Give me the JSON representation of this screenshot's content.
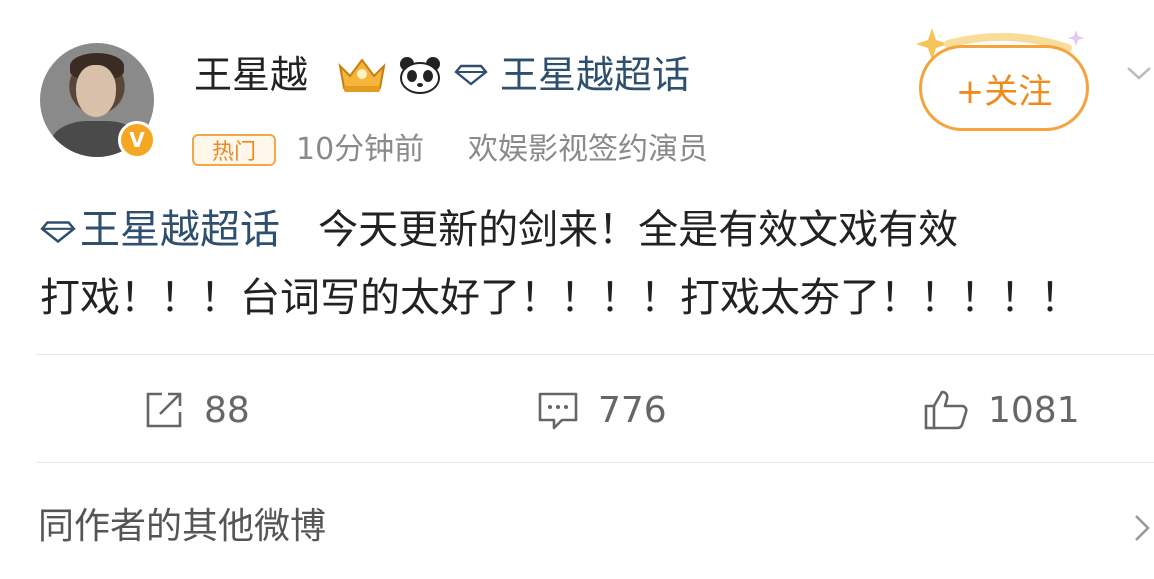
{
  "author": {
    "name": "王星越",
    "verified_mark": "V"
  },
  "header_topic": {
    "label": "王星越超话",
    "icon": "diamond-icon"
  },
  "follow_button": {
    "label": "+关注"
  },
  "meta": {
    "badge": "热门",
    "time": "10分钟前",
    "identity": "欢娱影视签约演员"
  },
  "post": {
    "topic_link": "王星越超话",
    "line1_text": "今天更新的剑来！全是有效文戏有效",
    "line2_text": "打戏！！！台词写的太好了！！！！打戏太夯了！！！！！"
  },
  "actions": {
    "repost": {
      "icon": "share-icon",
      "count": "88"
    },
    "comment": {
      "icon": "comment-icon",
      "count": "776"
    },
    "like": {
      "icon": "thumbs-up-icon",
      "count": "1081"
    }
  },
  "more_posts": {
    "label": "同作者的其他微博"
  },
  "colors": {
    "accent_orange": "#f08a1a",
    "topic_blue": "#2f4f6f",
    "verified": "#f5a623"
  }
}
